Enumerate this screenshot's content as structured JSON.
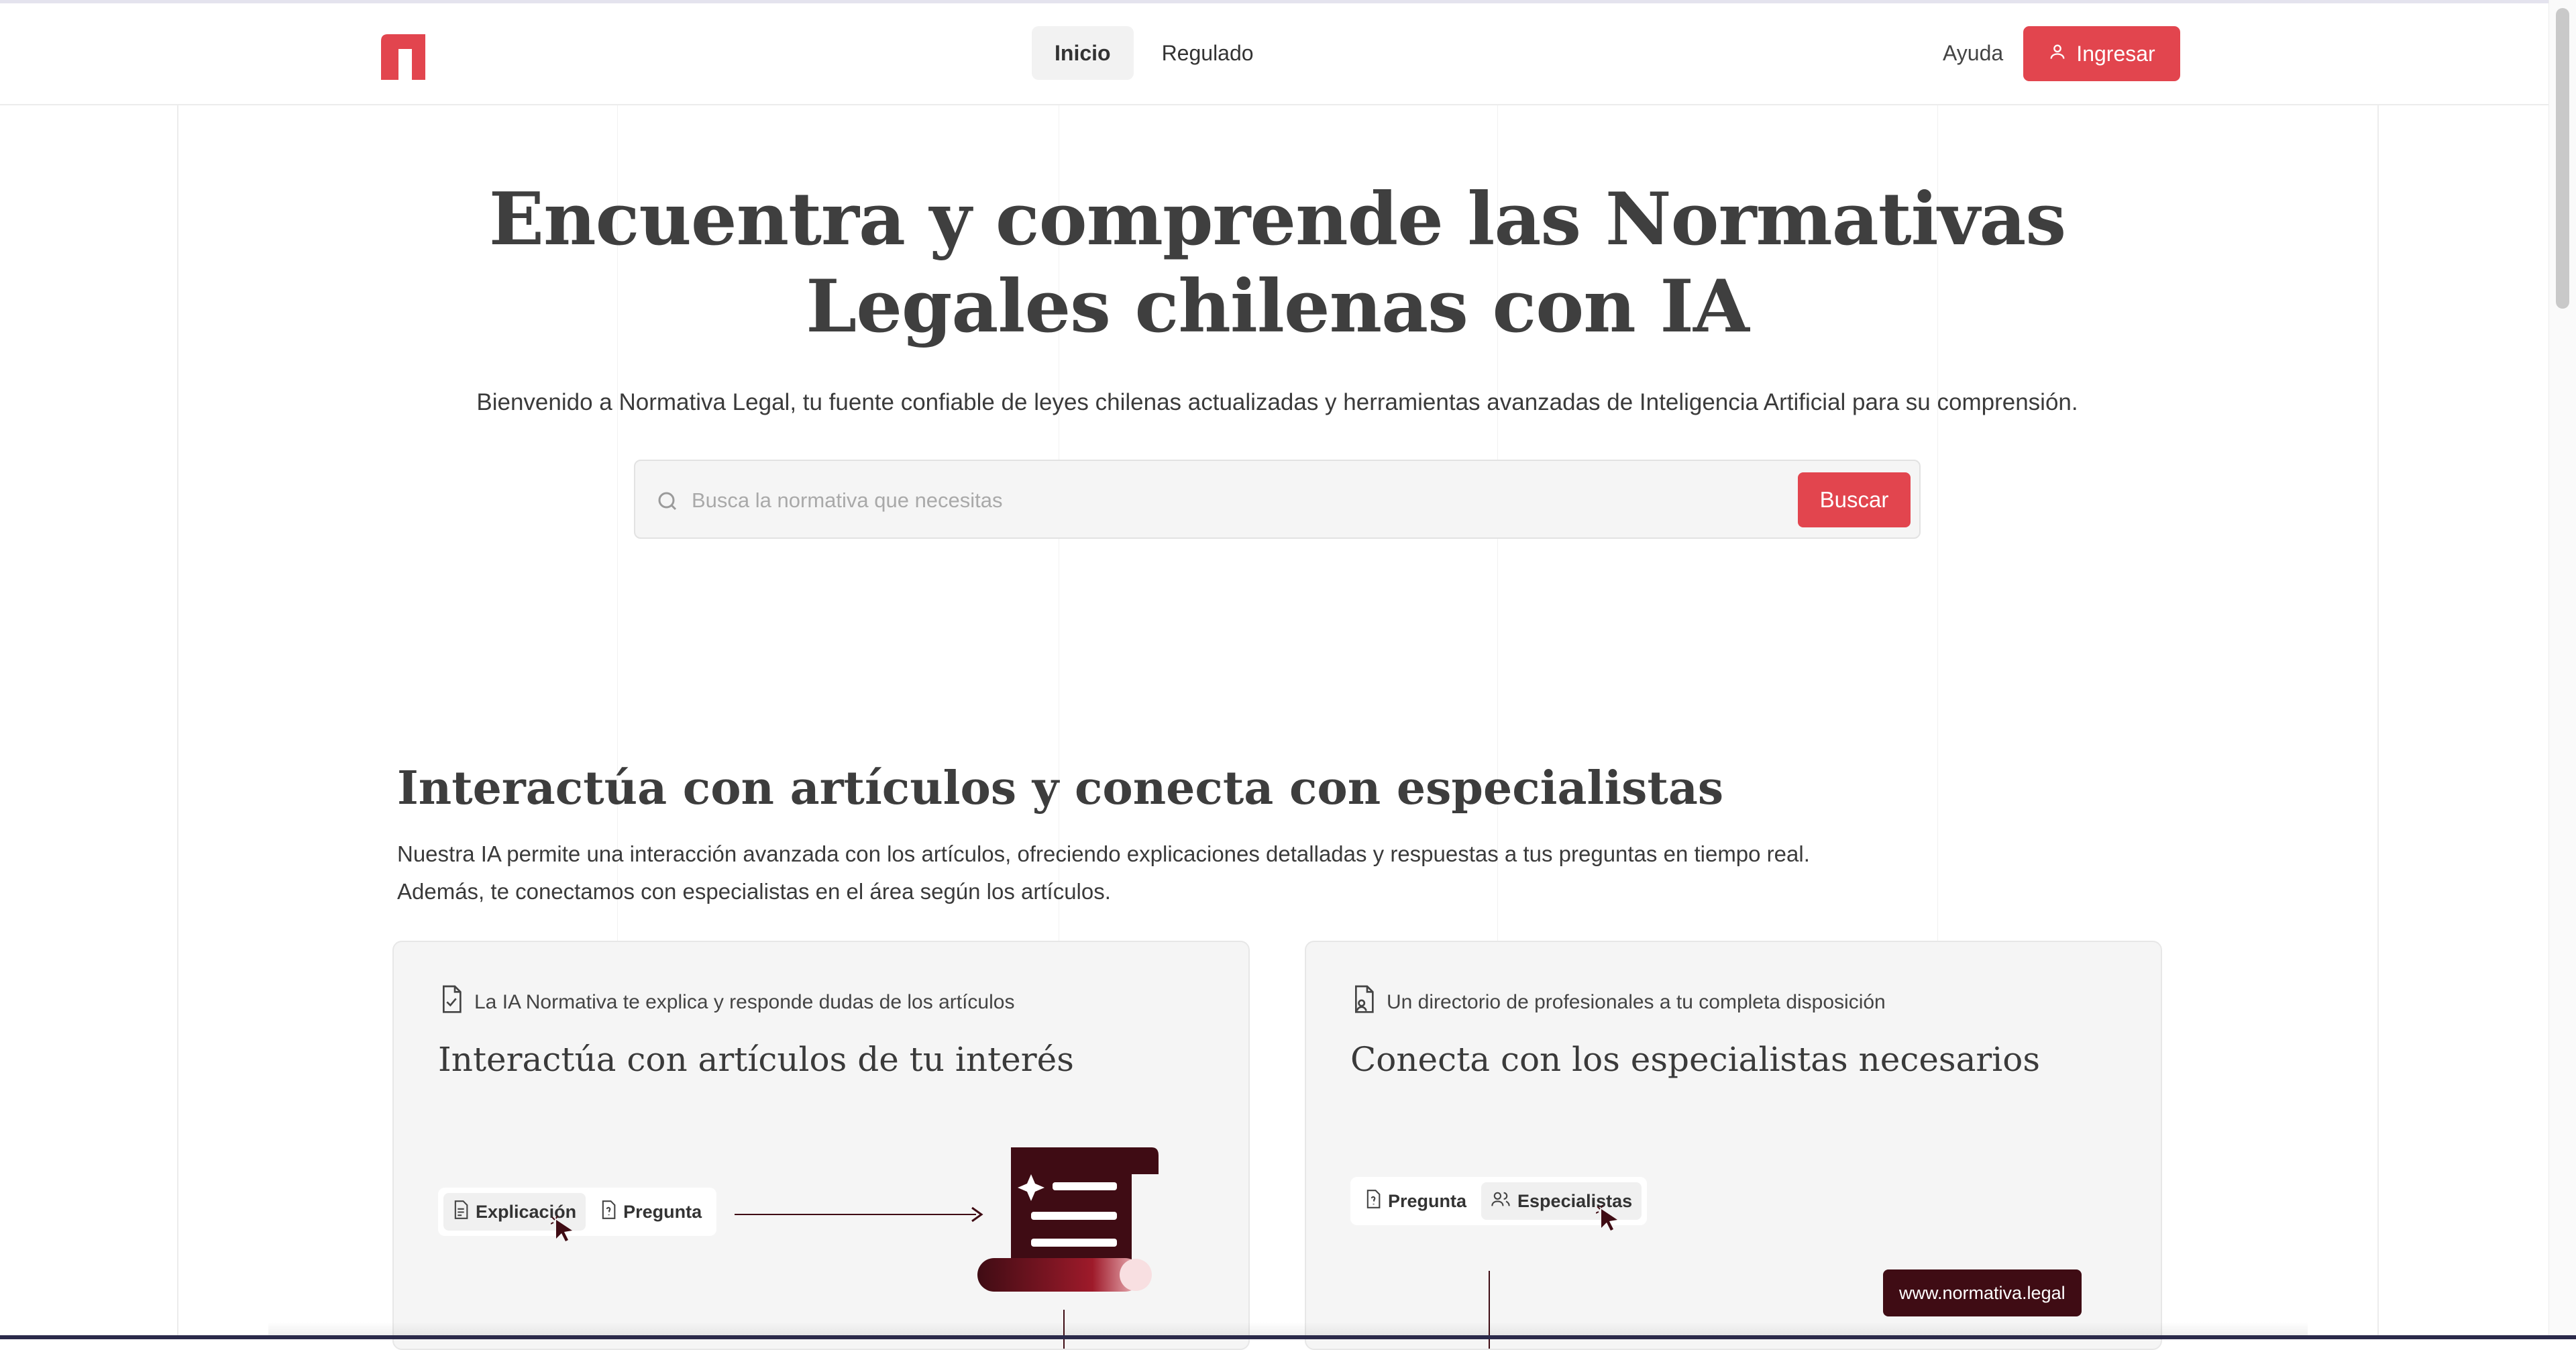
{
  "nav": {
    "logo_icon": "normativa-logo-icon",
    "links": [
      {
        "label": "Inicio",
        "active": true
      },
      {
        "label": "Regulado",
        "active": false
      }
    ],
    "help": "Ayuda",
    "login": {
      "label": "Ingresar",
      "icon": "user-icon"
    }
  },
  "hero": {
    "title_line1": "Encuentra y comprende las Normativas",
    "title_line2": "Legales chilenas con IA",
    "subtitle": "Bienvenido a Normativa Legal, tu fuente confiable de leyes chilenas actualizadas y herramientas avanzadas de Inteligencia Artificial para su comprensión.",
    "search_placeholder": "Busca la normativa que necesitas",
    "search_button": "Buscar"
  },
  "section": {
    "title": "Interactúa con artículos y conecta con especialistas",
    "line1": "Nuestra IA permite una interacción avanzada con los artículos, ofreciendo explicaciones detalladas y respuestas a tus preguntas en tiempo real.",
    "line2": "Además, te conectamos con especialistas en el área según los artículos."
  },
  "cards": [
    {
      "tag": "La IA Normativa te explica y responde dudas de los artículos",
      "tag_icon": "document-check-icon",
      "title": "Interactúa con artículos de tu interés",
      "pills": [
        {
          "label": "Explicación",
          "icon": "document-icon",
          "selected": true
        },
        {
          "label": "Pregunta",
          "icon": "question-document-icon",
          "selected": false
        }
      ]
    },
    {
      "tag": "Un directorio de profesionales a tu completa disposición",
      "tag_icon": "document-user-icon",
      "title": "Conecta con los especialistas necesarios",
      "pills": [
        {
          "label": "Pregunta",
          "icon": "question-document-icon",
          "selected": false
        },
        {
          "label": "Especialistas",
          "icon": "users-icon",
          "selected": true
        }
      ],
      "url": "www.normativa.legal"
    }
  ],
  "colors": {
    "accent": "#e2454e",
    "dark_accent": "#3f0c14",
    "heading": "#3f3f3f"
  }
}
